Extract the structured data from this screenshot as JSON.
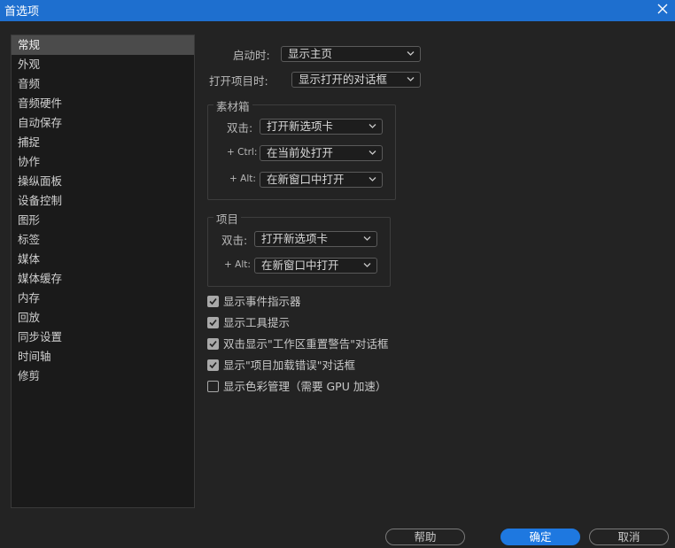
{
  "window": {
    "title": "首选项"
  },
  "sidebar": {
    "items": [
      "常规",
      "外观",
      "音频",
      "音频硬件",
      "自动保存",
      "捕捉",
      "协作",
      "操纵面板",
      "设备控制",
      "图形",
      "标签",
      "媒体",
      "媒体缓存",
      "内存",
      "回放",
      "同步设置",
      "时间轴",
      "修剪"
    ],
    "selected": "常规"
  },
  "general": {
    "startup_label": "启动时:",
    "startup_value": "显示主页",
    "open_project_label": "打开项目时:",
    "open_project_value": "显示打开的对话框"
  },
  "bins": {
    "title": "素材箱",
    "double_click_label": "双击:",
    "double_click_value": "打开新选项卡",
    "ctrl_label": "+ Ctrl:",
    "ctrl_value": "在当前处打开",
    "alt_label": "+ Alt:",
    "alt_value": "在新窗口中打开"
  },
  "projects": {
    "title": "项目",
    "double_click_label": "双击:",
    "double_click_value": "打开新选项卡",
    "alt_label": "+ Alt:",
    "alt_value": "在新窗口中打开"
  },
  "checkboxes": [
    {
      "label": "显示事件指示器",
      "checked": true
    },
    {
      "label": "显示工具提示",
      "checked": true
    },
    {
      "label": "双击显示\"工作区重置警告\"对话框",
      "checked": true
    },
    {
      "label": "显示\"项目加载错误\"对话框",
      "checked": true
    },
    {
      "label": "显示色彩管理（需要 GPU 加速）",
      "checked": false
    }
  ],
  "buttons": {
    "help": "帮助",
    "ok": "确定",
    "cancel": "取消"
  },
  "colors": {
    "titlebar": "#1e6fcf",
    "primary_button": "#1e78e0",
    "background": "#232323"
  }
}
